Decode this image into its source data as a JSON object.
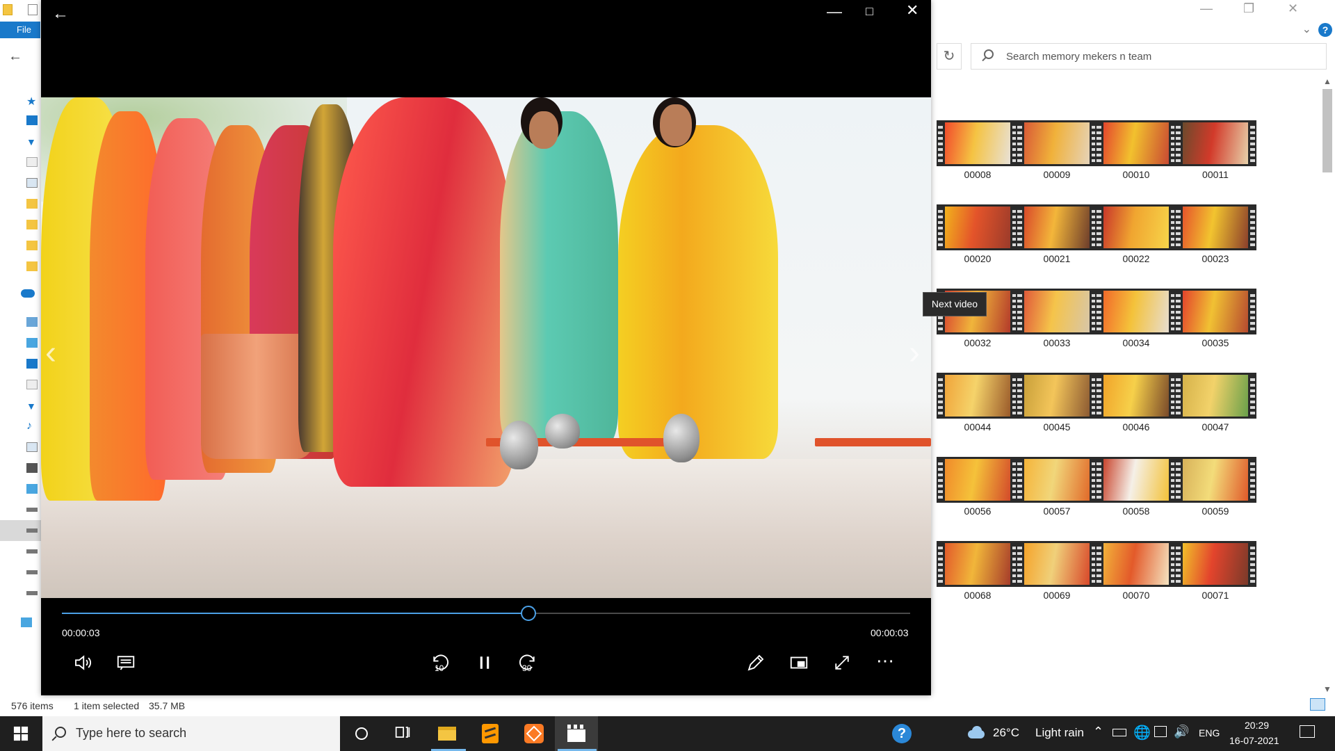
{
  "explorer": {
    "file_tab": "File",
    "search_placeholder": "Search memory mekers n team",
    "status": {
      "items": "576 items",
      "selected": "1 item selected",
      "size": "35.7 MB"
    },
    "thumbnails": [
      {
        "label": "00008"
      },
      {
        "label": "00009"
      },
      {
        "label": "00010"
      },
      {
        "label": "00011"
      },
      {
        "label": "00020"
      },
      {
        "label": "00021"
      },
      {
        "label": "00022"
      },
      {
        "label": "00023"
      },
      {
        "label": "00032"
      },
      {
        "label": "00033"
      },
      {
        "label": "00034"
      },
      {
        "label": "00035"
      },
      {
        "label": "00044"
      },
      {
        "label": "00045"
      },
      {
        "label": "00046"
      },
      {
        "label": "00047"
      },
      {
        "label": "00056"
      },
      {
        "label": "00057"
      },
      {
        "label": "00058"
      },
      {
        "label": "00059"
      },
      {
        "label": "00068"
      },
      {
        "label": "00069"
      },
      {
        "label": "00070"
      },
      {
        "label": "00071"
      }
    ]
  },
  "player": {
    "tooltip": "Next video",
    "time_current": "00:00:03",
    "time_total": "00:00:03",
    "progress": 0.55,
    "icons": {
      "back": "back-arrow-icon",
      "minimize": "minimize-icon",
      "maximize": "maximize-icon",
      "close": "close-icon",
      "volume": "volume-icon",
      "captions": "captions-icon",
      "rewind": "rewind-10-icon",
      "pause": "pause-icon",
      "forward": "forward-30-icon",
      "edit": "pencil-icon",
      "mini_view": "mini-view-icon",
      "fullscreen": "fullscreen-icon",
      "more": "more-icon"
    },
    "rewind_seconds": "10",
    "forward_seconds": "30"
  },
  "taskbar": {
    "search_placeholder": "Type here to search",
    "weather_temp": "26°C",
    "weather_desc": "Light rain",
    "language": "ENG",
    "time": "20:29",
    "date": "16-07-2021"
  },
  "colors": {
    "accent": "#4ba0e6",
    "file_tab": "#1979ca",
    "taskbar": "#1f1f1f"
  }
}
